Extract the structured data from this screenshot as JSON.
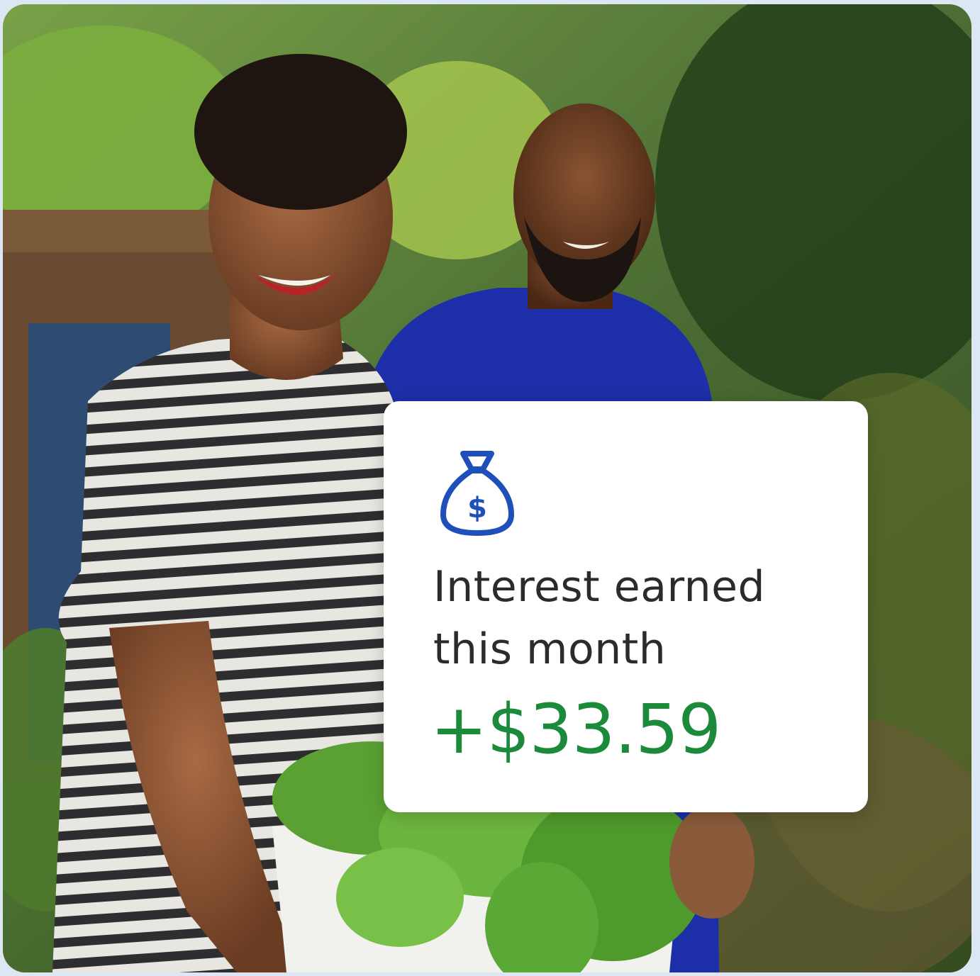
{
  "card": {
    "icon": "money-bag-dollar-icon",
    "label_line1": "Interest earned",
    "label_line2": "this month",
    "amount": "+$33.59"
  },
  "colors": {
    "accent_blue": "#1f4fb8",
    "amount_green": "#1b8a3a",
    "card_bg": "#ffffff",
    "text": "#2b2b2b"
  }
}
